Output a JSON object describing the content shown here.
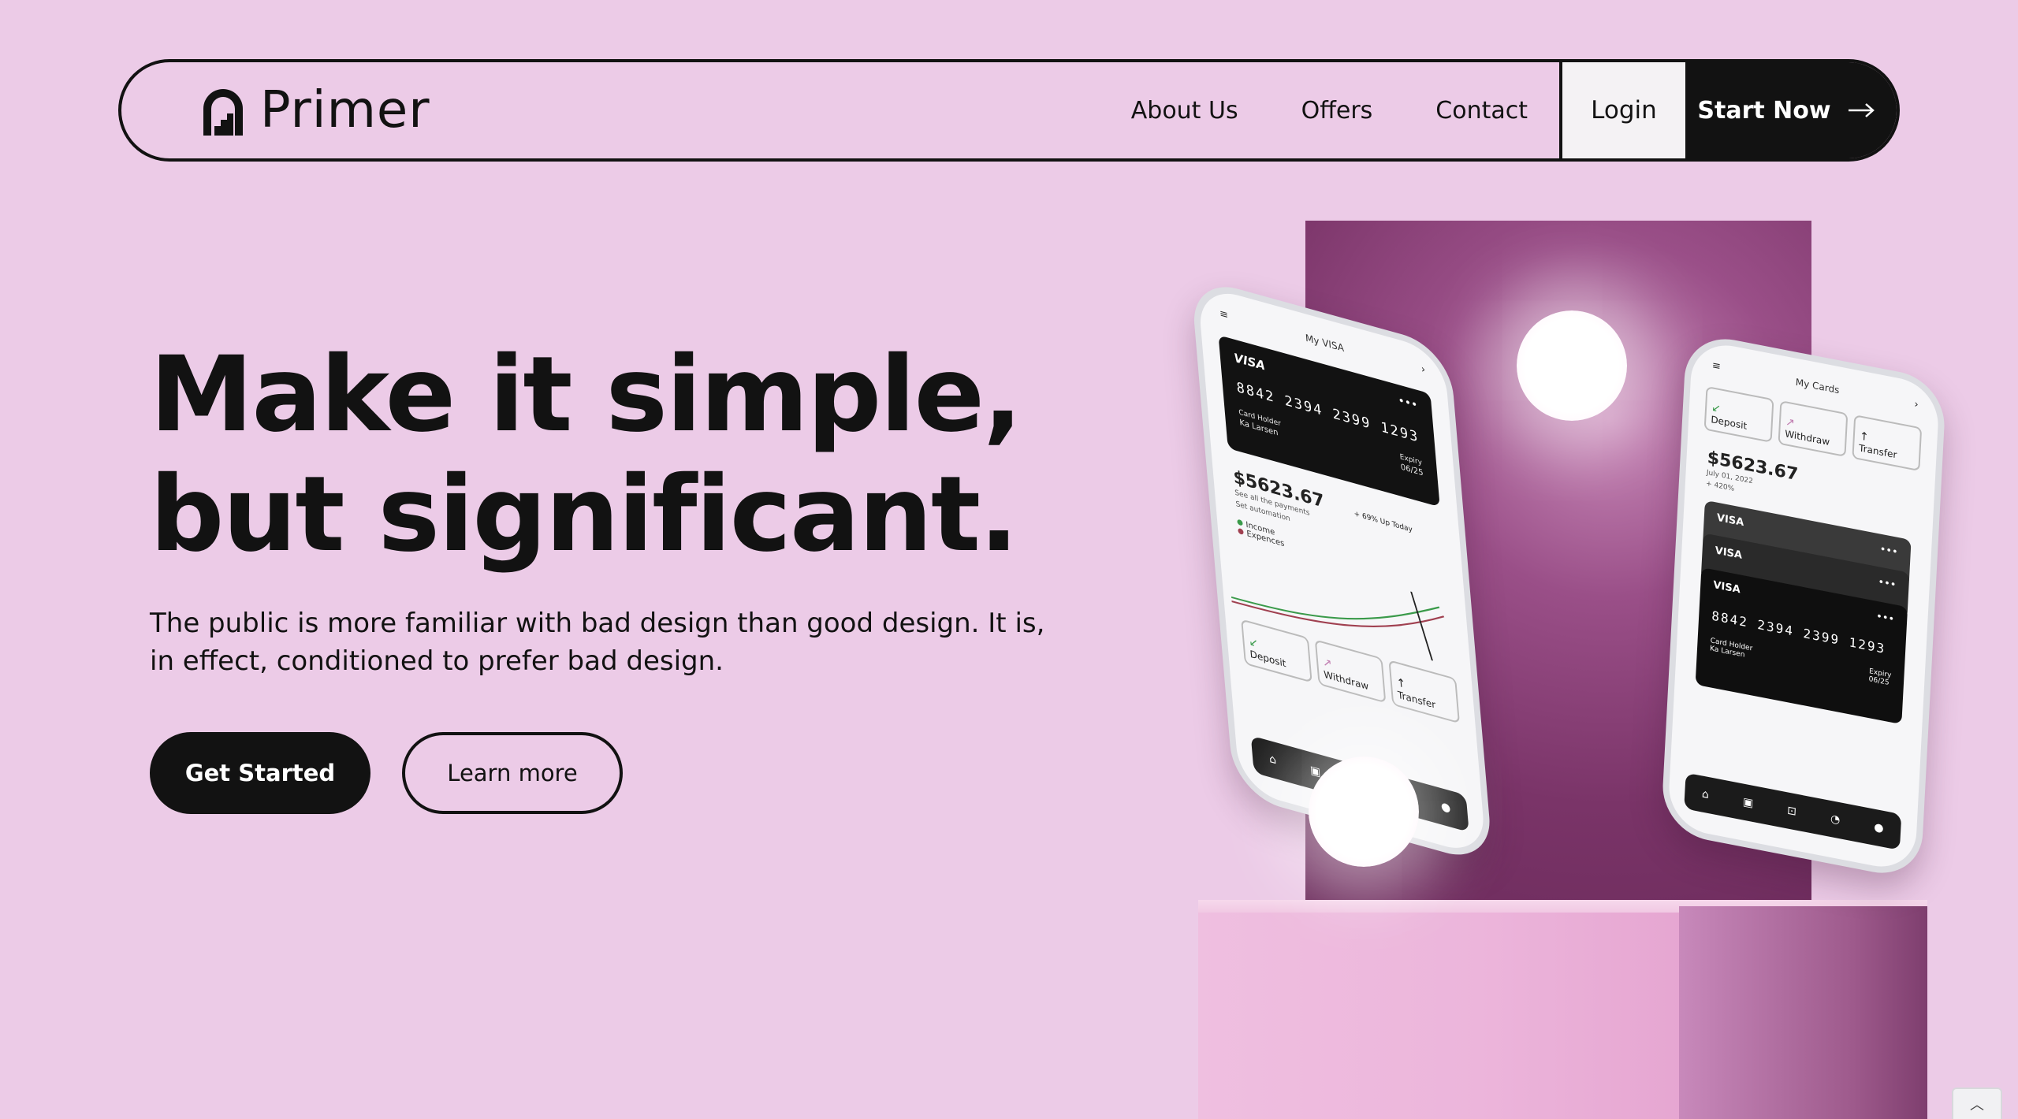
{
  "nav": {
    "brand": "Primer",
    "links": [
      "About Us",
      "Offers",
      "Contact"
    ],
    "login": "Login",
    "start": "Start Now"
  },
  "hero": {
    "title_line1": "Make it simple,",
    "title_line2": "but significant.",
    "subtitle": "The public is more familiar with bad design than good design. It is, in effect, conditioned to prefer bad design.",
    "cta_primary": "Get Started",
    "cta_secondary": "Learn more"
  },
  "phone_left": {
    "title": "My VISA",
    "card_brand": "VISA",
    "card_number": "8842  2394  2399  1293",
    "card_holder_label": "Card Holder",
    "card_holder": "Ka Larsen",
    "expiry_label": "Expiry",
    "expiry": "06/25",
    "balance": "$5623.67",
    "growth": "+ 69% Up Today",
    "note1": "See all the payments",
    "note2": "Set automation",
    "legend_income": "Income",
    "legend_expenses": "Expences",
    "actions": [
      "Deposit",
      "Withdraw",
      "Transfer"
    ]
  },
  "phone_right": {
    "title": "My Cards",
    "actions": [
      "Deposit",
      "Withdraw",
      "Transfer"
    ],
    "balance": "$5623.67",
    "date": "July 01, 2022",
    "growth": "+ 420%",
    "card_brand": "VISA",
    "card_number": "8842  2394  2399  1293",
    "card_holder_label": "Card Holder",
    "card_holder": "Ka Larsen",
    "expiry_label": "Expiry",
    "expiry": "06/25"
  },
  "colors": {
    "background": "#eccbe7",
    "ink": "#121212",
    "login_bg": "#f4f2f4",
    "panel": "#7a3468",
    "income": "#3a9a4a",
    "expenses": "#a04050"
  },
  "icons": [
    "brand-logo-icon",
    "arrow-right-icon",
    "menu-icon",
    "chevron-right-icon",
    "home-icon",
    "wallet-icon",
    "scan-icon",
    "pie-icon",
    "user-icon",
    "chevron-up-icon"
  ]
}
